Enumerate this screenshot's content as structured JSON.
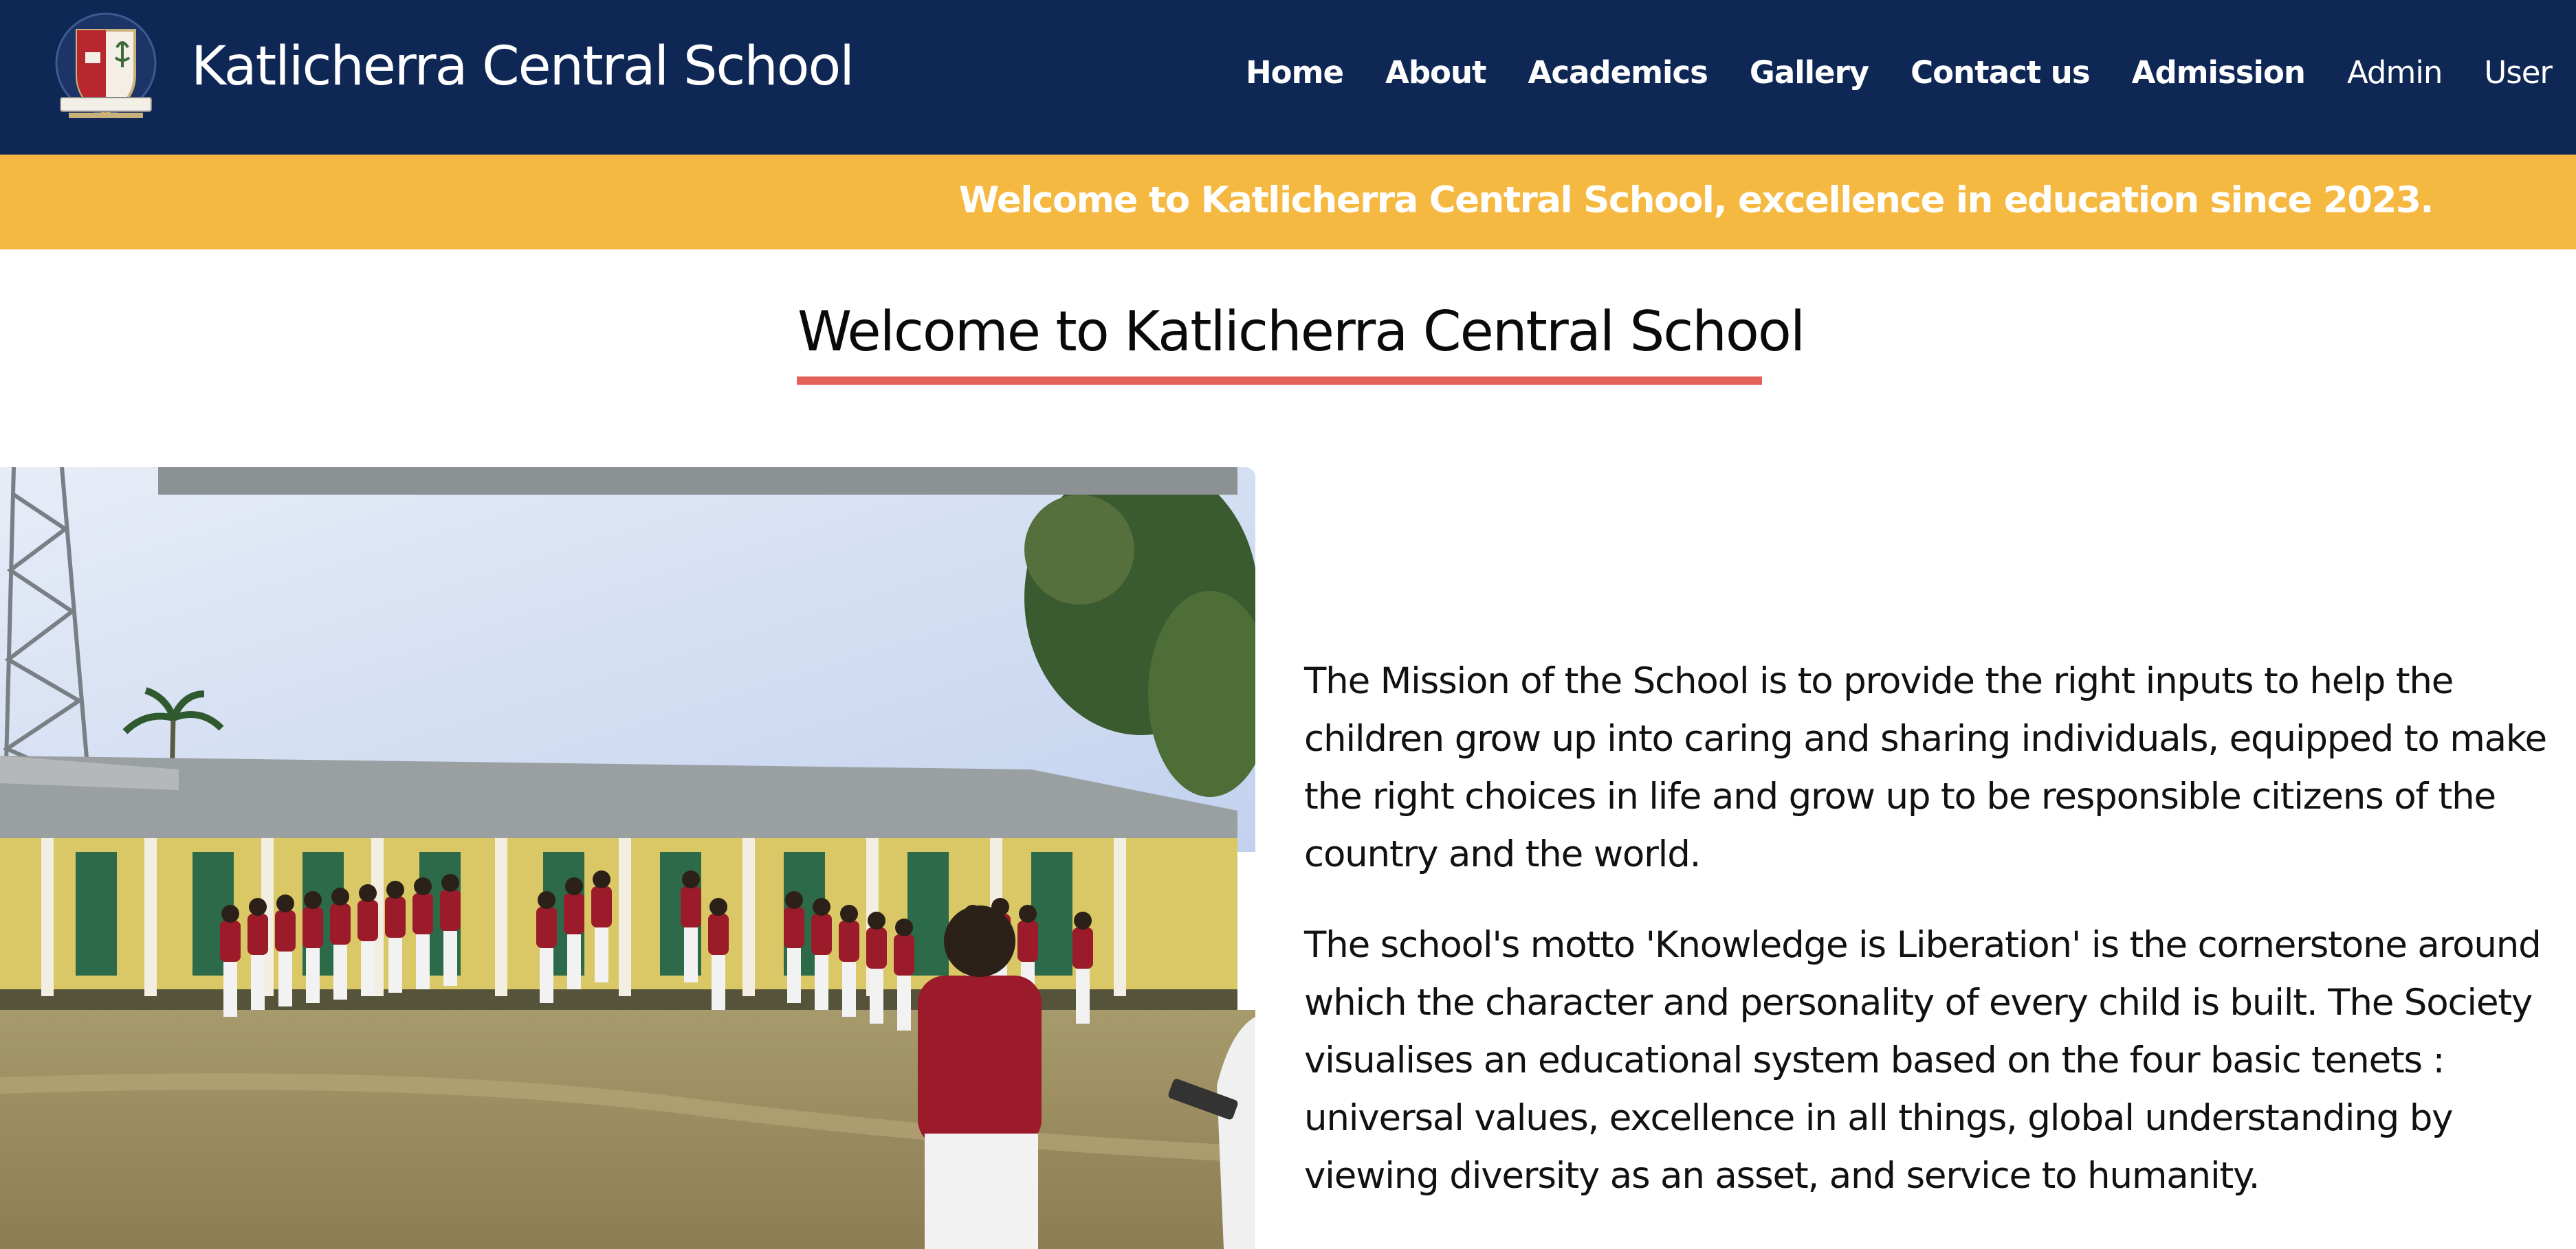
{
  "header": {
    "brand": "Katlicherra Central School",
    "logo_icon": "school-crest-icon",
    "nav": [
      {
        "label": "Home"
      },
      {
        "label": "About"
      },
      {
        "label": "Academics"
      },
      {
        "label": "Gallery"
      },
      {
        "label": "Contact us"
      },
      {
        "label": "Admission"
      },
      {
        "label": "Admin"
      },
      {
        "label": "User"
      }
    ]
  },
  "ticker": {
    "text": "Welcome to Katlicherra Central School, excellence in education since 2023."
  },
  "main": {
    "heading": "Welcome to Katlicherra Central School",
    "mission_paragraphs": [
      "The Mission of the School is to provide the right inputs to help the children grow up into caring and sharing individuals, equipped to make the right choices in life and grow up to be responsible citizens of the country and the world.",
      "The school's motto 'Knowledge is Liberation' is the cornerstone around which the character and personality of every child is built. The Society visualises an educational system based on the four basic tenets : universal values, excellence in all things, global understanding by viewing diversity as an asset, and service to humanity."
    ]
  },
  "colors": {
    "navbar": "#0e2754",
    "ticker": "#f5b942",
    "underline": "#e1605a",
    "uniform": "#9b1b2a"
  }
}
